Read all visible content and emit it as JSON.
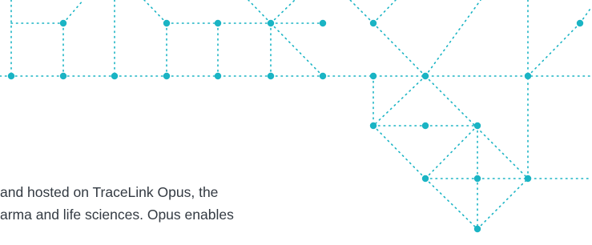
{
  "colors": {
    "accent": "#1ab4c4",
    "text": "#333a42",
    "background": "#ffffff"
  },
  "body_text": {
    "line1": "and hosted on TraceLink Opus, the",
    "line2": "arma and life sciences. Opus enables"
  }
}
